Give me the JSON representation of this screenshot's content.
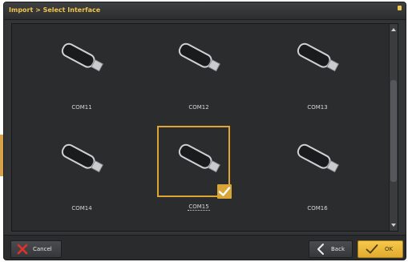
{
  "window": {
    "title": "Import > Select Interface"
  },
  "interfaces": [
    {
      "label": "COM11",
      "selected": false
    },
    {
      "label": "COM12",
      "selected": false
    },
    {
      "label": "COM13",
      "selected": false
    },
    {
      "label": "COM14",
      "selected": false
    },
    {
      "label": "COM15",
      "selected": true
    },
    {
      "label": "COM16",
      "selected": false
    }
  ],
  "icons": {
    "interface": "usb-stick-icon",
    "selected_marker": "checkmark-icon",
    "cancel": "red-x-icon",
    "back": "chevron-left-icon",
    "ok": "checkmark-icon"
  },
  "buttons": {
    "cancel_label": "Cancel",
    "back_label": "Back",
    "ok_label": "OK"
  },
  "colors": {
    "accent": "#f0c54a",
    "selection": "#e0a436",
    "cancel_icon": "#e0322b"
  }
}
